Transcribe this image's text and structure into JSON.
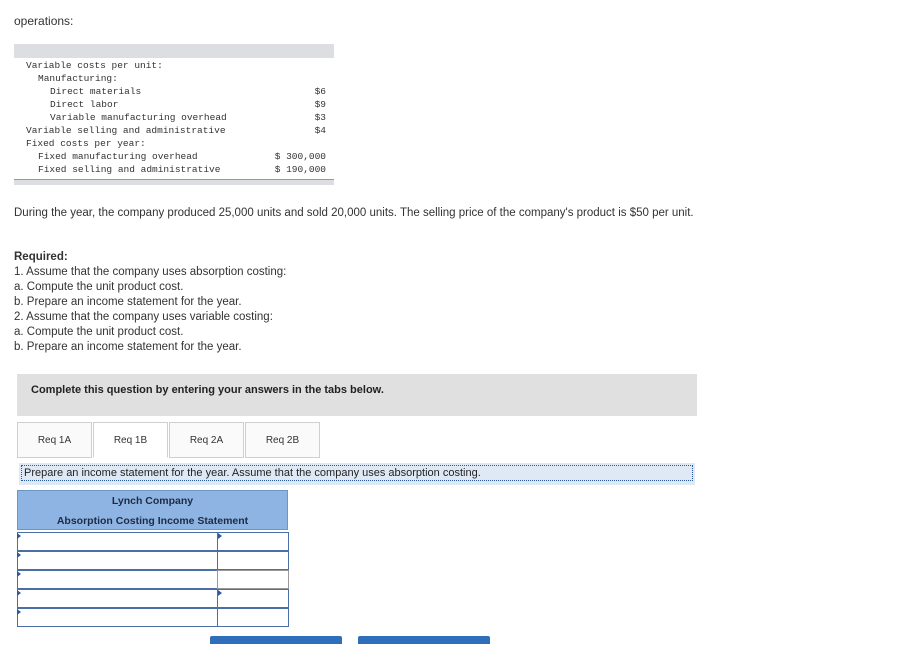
{
  "intro": "operations:",
  "cost_table": {
    "rows": [
      {
        "label": "Variable costs per unit:",
        "value": "",
        "indent": 0
      },
      {
        "label": "Manufacturing:",
        "value": "",
        "indent": 1
      },
      {
        "label": "Direct materials",
        "value": "$6",
        "indent": 2
      },
      {
        "label": "Direct labor",
        "value": "$9",
        "indent": 2
      },
      {
        "label": "Variable manufacturing overhead",
        "value": "$3",
        "indent": 2
      },
      {
        "label": "Variable selling and administrative",
        "value": "$4",
        "indent": 0
      },
      {
        "label": "Fixed costs per year:",
        "value": "",
        "indent": 0
      },
      {
        "label": "Fixed manufacturing overhead",
        "value": "$ 300,000",
        "indent": 1
      },
      {
        "label": "Fixed selling and administrative",
        "value": "$ 190,000",
        "indent": 1
      }
    ]
  },
  "description": "During the year, the company produced 25,000 units and sold 20,000 units. The selling price of the company's product is $50 per unit.",
  "required": {
    "title": "Required:",
    "items": [
      "1. Assume that the company uses absorption costing:",
      "a. Compute the unit product cost.",
      "b. Prepare an income statement for the year.",
      "2. Assume that the company uses variable costing:",
      "a. Compute the unit product cost.",
      "b. Prepare an income statement for the year."
    ]
  },
  "complete_banner": "Complete this question by entering your answers in the tabs below.",
  "tabs": [
    {
      "label": "Req 1A",
      "active": false
    },
    {
      "label": "Req 1B",
      "active": true
    },
    {
      "label": "Req 2A",
      "active": false
    },
    {
      "label": "Req 2B",
      "active": false
    }
  ],
  "instruction": "Prepare an income statement for the year. Assume that the company uses absorption costing.",
  "statement": {
    "company": "Lynch Company",
    "title": "Absorption Costing Income Statement"
  },
  "colors": {
    "header_blue": "#8db4e2",
    "instruction_bg": "#dfe9f5",
    "button_blue": "#2f6eb8",
    "banner_gray": "#e0e0e0"
  }
}
